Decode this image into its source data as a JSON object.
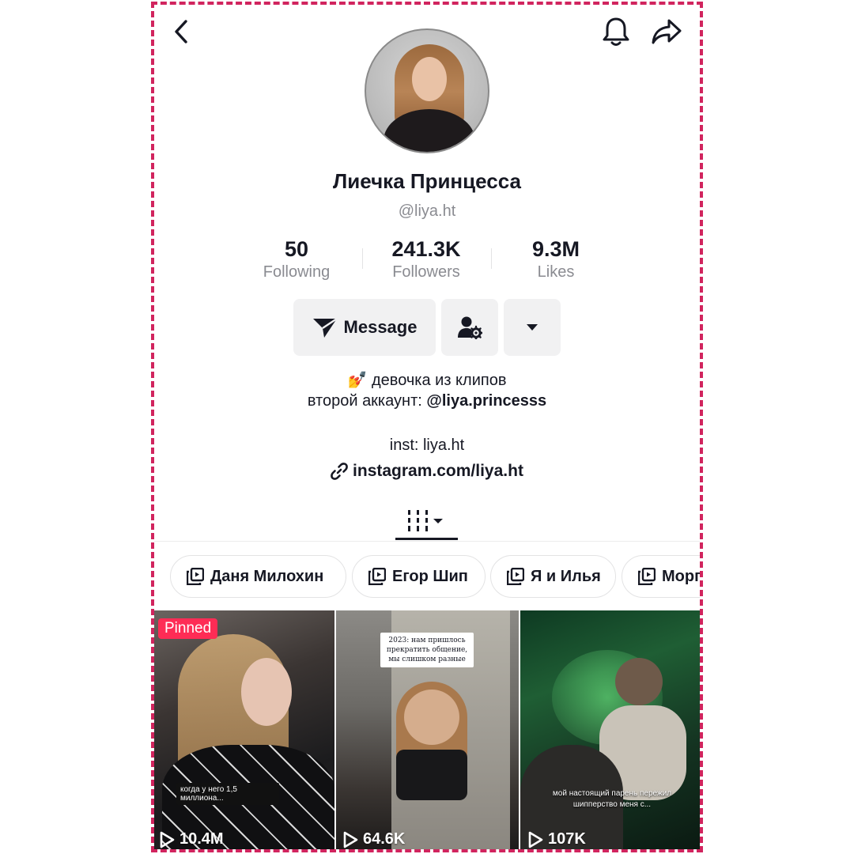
{
  "profile": {
    "display_name": "Лиечка Принцесса",
    "username": "@liya.ht"
  },
  "stats": [
    {
      "value": "50",
      "label": "Following"
    },
    {
      "value": "241.3K",
      "label": "Followers"
    },
    {
      "value": "9.3M",
      "label": "Likes"
    }
  ],
  "actions": {
    "message_label": "Message"
  },
  "bio": {
    "line1_emoji": "💅",
    "line1_text": " девочка из клипов",
    "line2_prefix": "второй аккаунт: ",
    "line2_mention": "@liya.princesss",
    "line3": "inst: liya.ht",
    "link": "instagram.com/liya.ht"
  },
  "playlists": [
    {
      "label": "Даня Милохин"
    },
    {
      "label": "Егор Шип"
    },
    {
      "label": "Я и Илья"
    },
    {
      "label": "Морг"
    }
  ],
  "videos": [
    {
      "badge": "Pinned",
      "caption": "когда у него 1,5 миллиона...",
      "views": "10.4M"
    },
    {
      "caption": "2023: нам пришлось прекратить общение, мы слишком разные",
      "views": "64.6K"
    },
    {
      "caption": "мой настоящий парень пережил шипперство меня с...",
      "views": "107K"
    }
  ],
  "colors": {
    "accent": "#fe2c55",
    "frame": "#d1245e",
    "text": "#161823",
    "secondary_text": "#8a8b91"
  }
}
